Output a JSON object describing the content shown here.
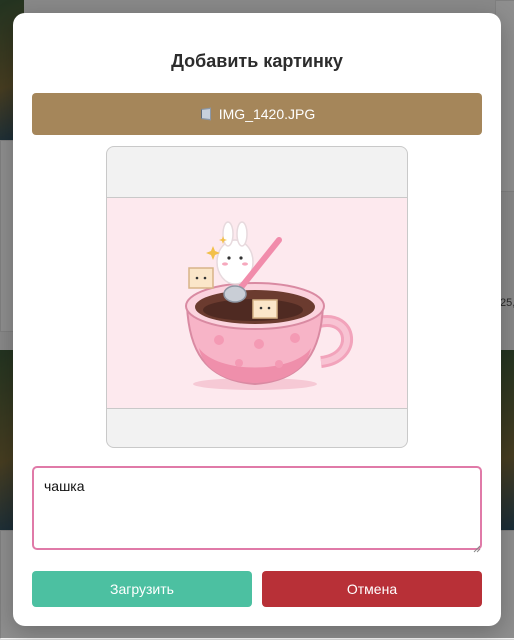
{
  "modal": {
    "title": "Добавить картинку",
    "file_button_label": "IMG_1420.JPG",
    "caption_value": "чашка",
    "upload_label": "Загрузить",
    "cancel_label": "Отмена"
  },
  "background": {
    "side_text": "25,"
  },
  "icons": {
    "file": "file-icon",
    "preview": "bunny-coffee-cup-image"
  },
  "colors": {
    "file_button": "#a5865a",
    "caption_border": "#e07aa8",
    "upload": "#4cc0a1",
    "cancel": "#b83037"
  }
}
